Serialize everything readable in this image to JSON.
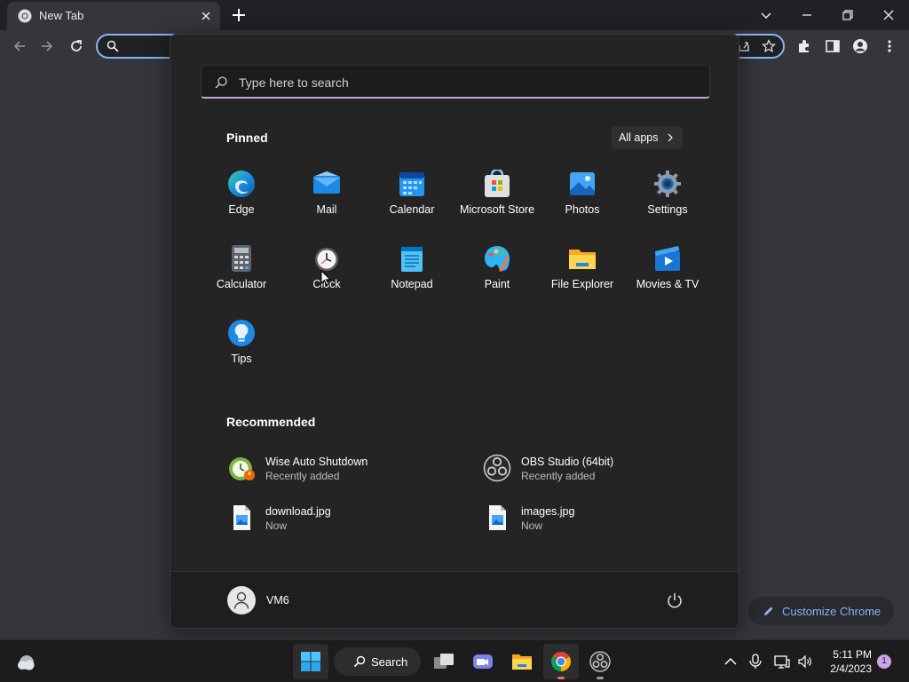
{
  "chrome": {
    "tab_title": "New Tab",
    "customize_label": "Customize Chrome",
    "accent": "#8ab4f8"
  },
  "start_menu": {
    "search_placeholder": "Type here to search",
    "pinned_title": "Pinned",
    "all_apps_label": "All apps",
    "pinned_apps": [
      {
        "label": "Edge",
        "icon": "edge-icon"
      },
      {
        "label": "Mail",
        "icon": "mail-icon"
      },
      {
        "label": "Calendar",
        "icon": "calendar-icon"
      },
      {
        "label": "Microsoft Store",
        "icon": "store-icon"
      },
      {
        "label": "Photos",
        "icon": "photos-icon"
      },
      {
        "label": "Settings",
        "icon": "settings-icon"
      },
      {
        "label": "Calculator",
        "icon": "calculator-icon"
      },
      {
        "label": "Clock",
        "icon": "clock-icon"
      },
      {
        "label": "Notepad",
        "icon": "notepad-icon"
      },
      {
        "label": "Paint",
        "icon": "paint-icon"
      },
      {
        "label": "File Explorer",
        "icon": "folder-icon"
      },
      {
        "label": "Movies & TV",
        "icon": "movies-icon"
      },
      {
        "label": "Tips",
        "icon": "tips-icon"
      }
    ],
    "recommended_title": "Recommended",
    "recommended": [
      {
        "name": "Wise Auto Shutdown",
        "sub": "Recently added",
        "icon": "wise-shutdown-icon"
      },
      {
        "name": "OBS Studio (64bit)",
        "sub": "Recently added",
        "icon": "obs-icon"
      },
      {
        "name": "download.jpg",
        "sub": "Now",
        "icon": "image-file-icon"
      },
      {
        "name": "images.jpg",
        "sub": "Now",
        "icon": "image-file-icon"
      }
    ],
    "user_name": "VM6"
  },
  "taskbar": {
    "search_label": "Search",
    "time": "5:11 PM",
    "date": "2/4/2023",
    "notification_count": "1"
  }
}
